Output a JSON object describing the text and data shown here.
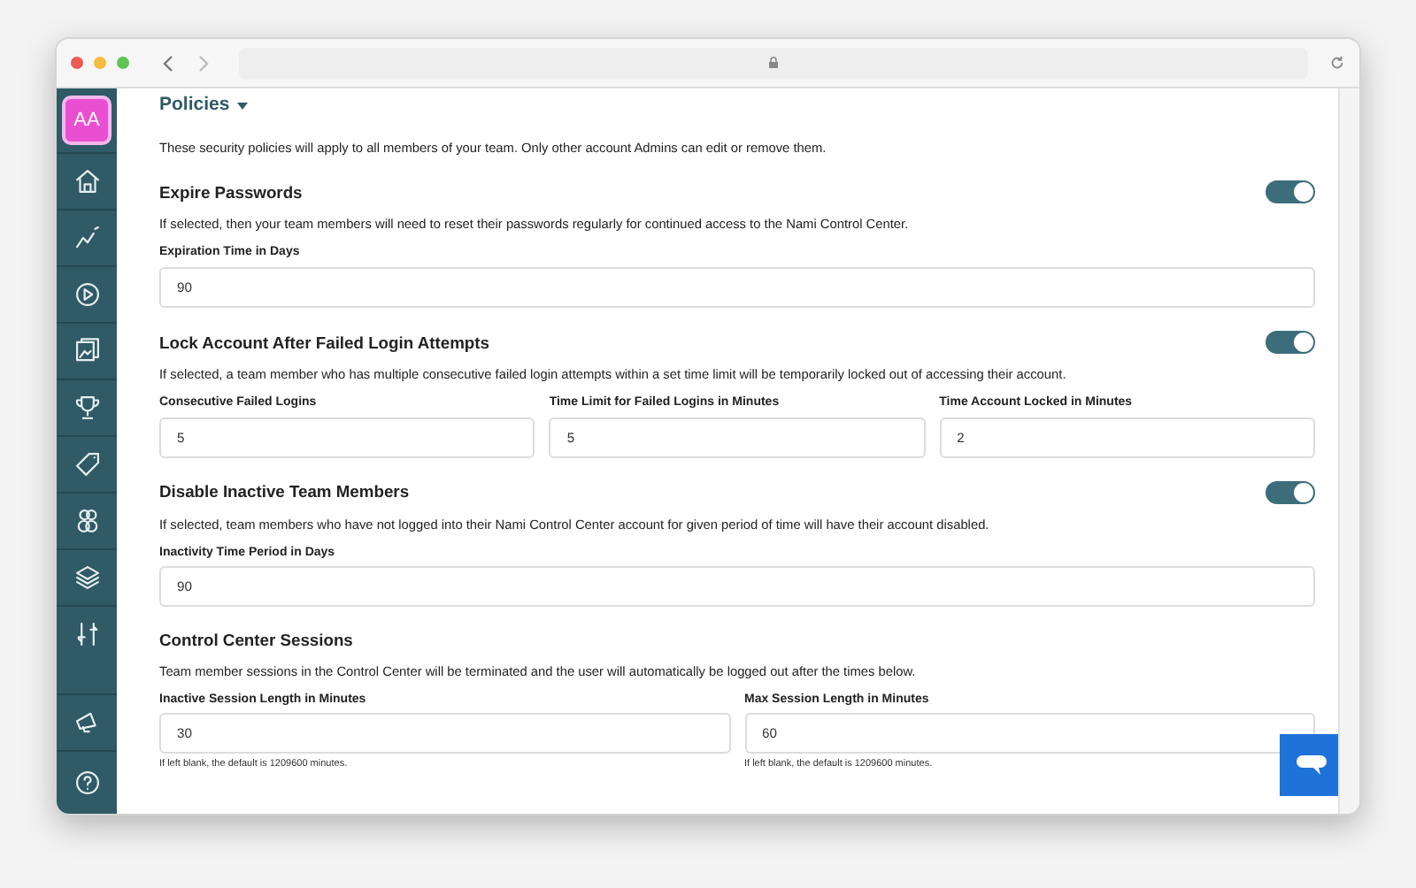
{
  "sidebar": {
    "avatar": "AA",
    "items": [
      {
        "selected": false
      },
      {
        "selected": false
      },
      {
        "selected": false
      },
      {
        "selected": false
      },
      {
        "selected": false
      },
      {
        "selected": false
      },
      {
        "selected": false
      },
      {
        "selected": false
      },
      {
        "selected": false
      }
    ],
    "bottom_items": [
      {
        "selected": false
      },
      {
        "selected": false
      }
    ]
  },
  "page": {
    "title": "Policies",
    "intro": "These security policies will apply to all members of your team. Only other account Admins can edit or remove them."
  },
  "sections": [
    {
      "title": "Expire Passwords",
      "toggle": {
        "on": true
      },
      "description": "If selected, then your team members will need to reset their passwords regularly for continued access to the Nami Control Center.",
      "fields": [
        {
          "label": "Expiration Time in Days",
          "value": "90"
        }
      ]
    },
    {
      "title": "Lock Account After Failed Login Attempts",
      "toggle": {
        "on": true
      },
      "description": "If selected, a team member who has multiple consecutive failed login attempts within a set time limit will be temporarily locked out of accessing their account.",
      "fields": [
        {
          "label": "Consecutive Failed Logins",
          "value": "5"
        },
        {
          "label": "Time Limit for Failed Logins in Minutes",
          "value": "5"
        },
        {
          "label": "Time Account Locked in Minutes",
          "value": "2"
        }
      ]
    },
    {
      "title": "Disable Inactive Team Members",
      "toggle": {
        "on": true
      },
      "description": "If selected, team members who have not logged into their Nami Control Center account for given period of time will have their account disabled.",
      "fields": [
        {
          "label": "Inactivity Time Period in Days",
          "value": "90"
        }
      ]
    },
    {
      "title": "Control Center Sessions",
      "description": "Team member sessions in the Control Center will be terminated and the user will automatically be logged out after the times below.",
      "fields": [
        {
          "label": "Inactive Session Length in Minutes",
          "value": "30",
          "hint": "If left blank, the default is 1209600 minutes."
        },
        {
          "label": "Max Session Length in Minutes",
          "value": "60",
          "hint": "If left blank, the default is 1209600 minutes."
        }
      ]
    }
  ]
}
